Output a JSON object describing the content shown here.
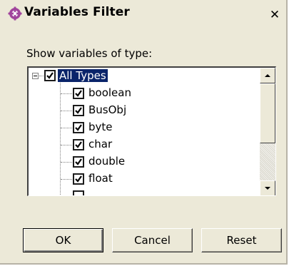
{
  "window": {
    "title": "Variables Filter",
    "close_glyph": "✕"
  },
  "filter": {
    "label": "Show variables of type:",
    "root": {
      "label": "All Types",
      "checked": true,
      "expanded": true
    },
    "items": [
      {
        "label": "boolean",
        "checked": true
      },
      {
        "label": "BusObj",
        "checked": true
      },
      {
        "label": "byte",
        "checked": true
      },
      {
        "label": "char",
        "checked": true
      },
      {
        "label": "double",
        "checked": true
      },
      {
        "label": "float",
        "checked": true
      }
    ]
  },
  "buttons": {
    "ok": "OK",
    "cancel": "Cancel",
    "reset": "Reset"
  },
  "colors": {
    "selection": "#0a246a",
    "dialog_bg": "#ece9d8",
    "title_icon": "#a0449c"
  },
  "icons": {
    "title": "crosshair-app-icon",
    "close": "close-icon",
    "scroll_up": "arrow-up-icon",
    "scroll_down": "arrow-down-icon",
    "expander": "tree-collapse-icon"
  }
}
